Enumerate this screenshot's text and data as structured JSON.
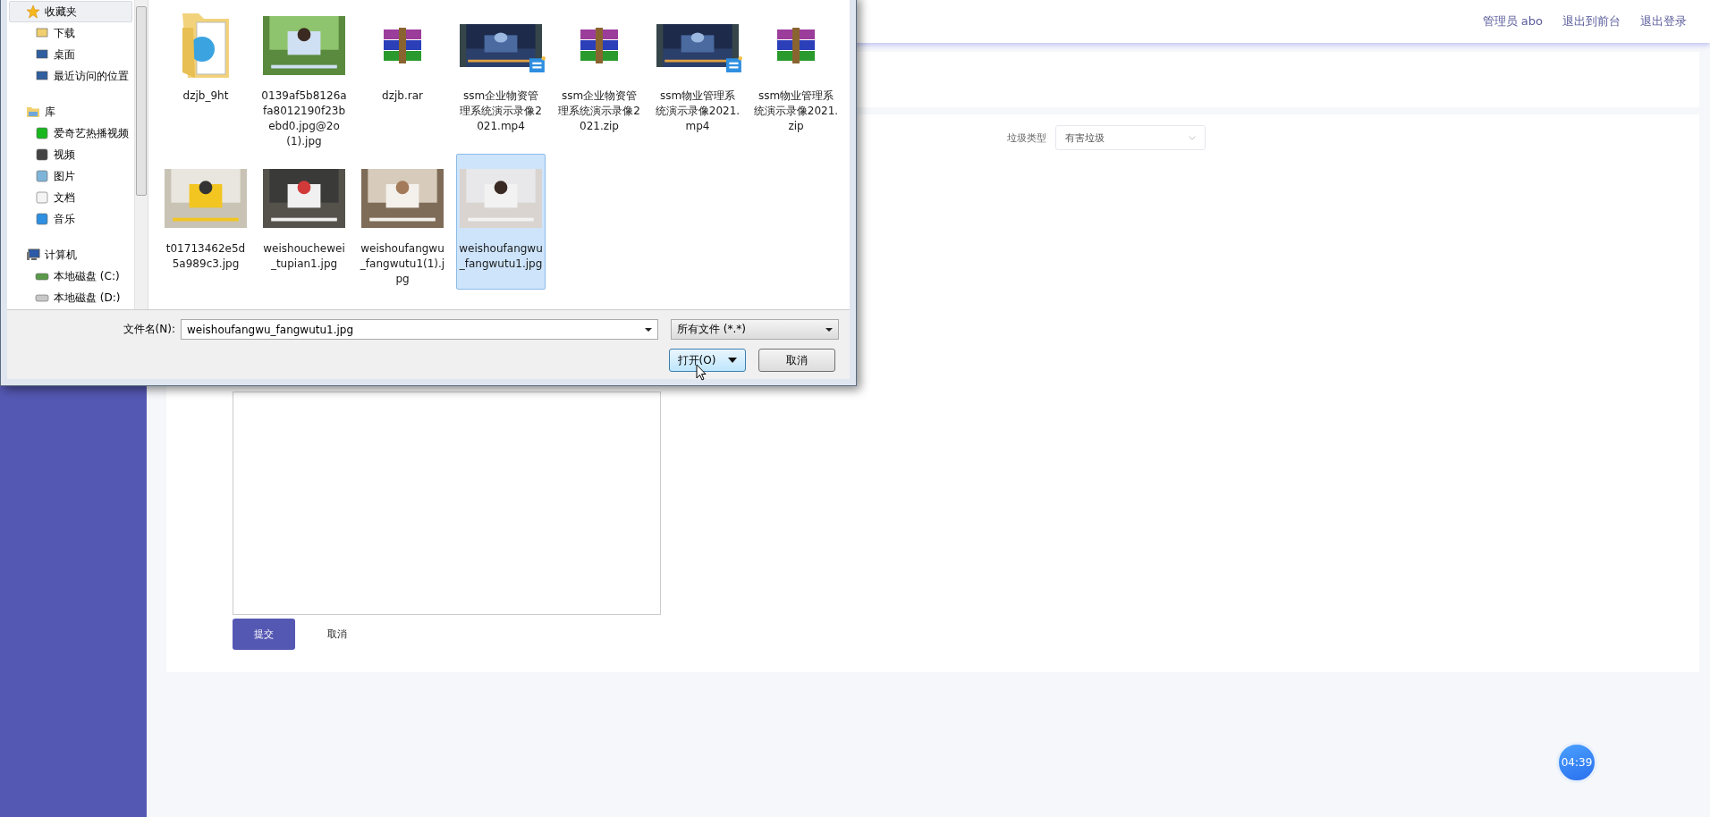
{
  "header": {
    "user": "管理员 abo",
    "links": [
      "退出到前台",
      "退出登录"
    ]
  },
  "form": {
    "field_label": "垃圾类型",
    "field_value": "有害垃圾",
    "submit": "提交",
    "cancel": "取消"
  },
  "timer": "04:39",
  "dialog": {
    "nav": [
      {
        "label": "收藏夹",
        "selected": true,
        "children": [
          {
            "label": "下载",
            "selected": false
          },
          {
            "label": "桌面",
            "selected": false
          },
          {
            "label": "最近访问的位置",
            "selected": false
          }
        ]
      },
      {
        "label": "库",
        "selected": false,
        "children": [
          {
            "label": "爱奇艺热播视频",
            "selected": false
          },
          {
            "label": "视频",
            "selected": false
          },
          {
            "label": "图片",
            "selected": false
          },
          {
            "label": "文档",
            "selected": false
          },
          {
            "label": "音乐",
            "selected": false
          }
        ]
      },
      {
        "label": "计算机",
        "selected": false,
        "children": [
          {
            "label": "本地磁盘 (C:)",
            "selected": false
          },
          {
            "label": "本地磁盘 (D:)",
            "selected": false
          }
        ]
      }
    ],
    "files": [
      {
        "name": "dzjb_9ht",
        "kind": "folder",
        "selected": false
      },
      {
        "name": "0139af5b8126afa8012190f23bebd0.jpg@2o(1).jpg",
        "kind": "picture",
        "selected": false
      },
      {
        "name": "dzjb.rar",
        "kind": "archive",
        "selected": false
      },
      {
        "name": "ssm企业物资管理系统演示录像2021.mp4",
        "kind": "video",
        "selected": false
      },
      {
        "name": "ssm企业物资管理系统演示录像2021.zip",
        "kind": "archive",
        "selected": false
      },
      {
        "name": "ssm物业管理系统演示录像2021.mp4",
        "kind": "video",
        "selected": false
      },
      {
        "name": "ssm物业管理系统演示录像2021.zip",
        "kind": "archive",
        "selected": false
      },
      {
        "name": "t01713462e5d5a989c3.jpg",
        "kind": "picture",
        "selected": false
      },
      {
        "name": "weishouchewei_tupian1.jpg",
        "kind": "picture",
        "selected": false
      },
      {
        "name": "weishoufangwu_fangwutu1(1).jpg",
        "kind": "picture",
        "selected": false
      },
      {
        "name": "weishoufangwu_fangwutu1.jpg",
        "kind": "picture",
        "selected": true
      }
    ],
    "filename_label": "文件名(N):",
    "filename_value": "weishoufangwu_fangwutu1.jpg",
    "filter_value": "所有文件 (*.*)",
    "open_button": "打开(O)",
    "cancel_button": "取消"
  }
}
